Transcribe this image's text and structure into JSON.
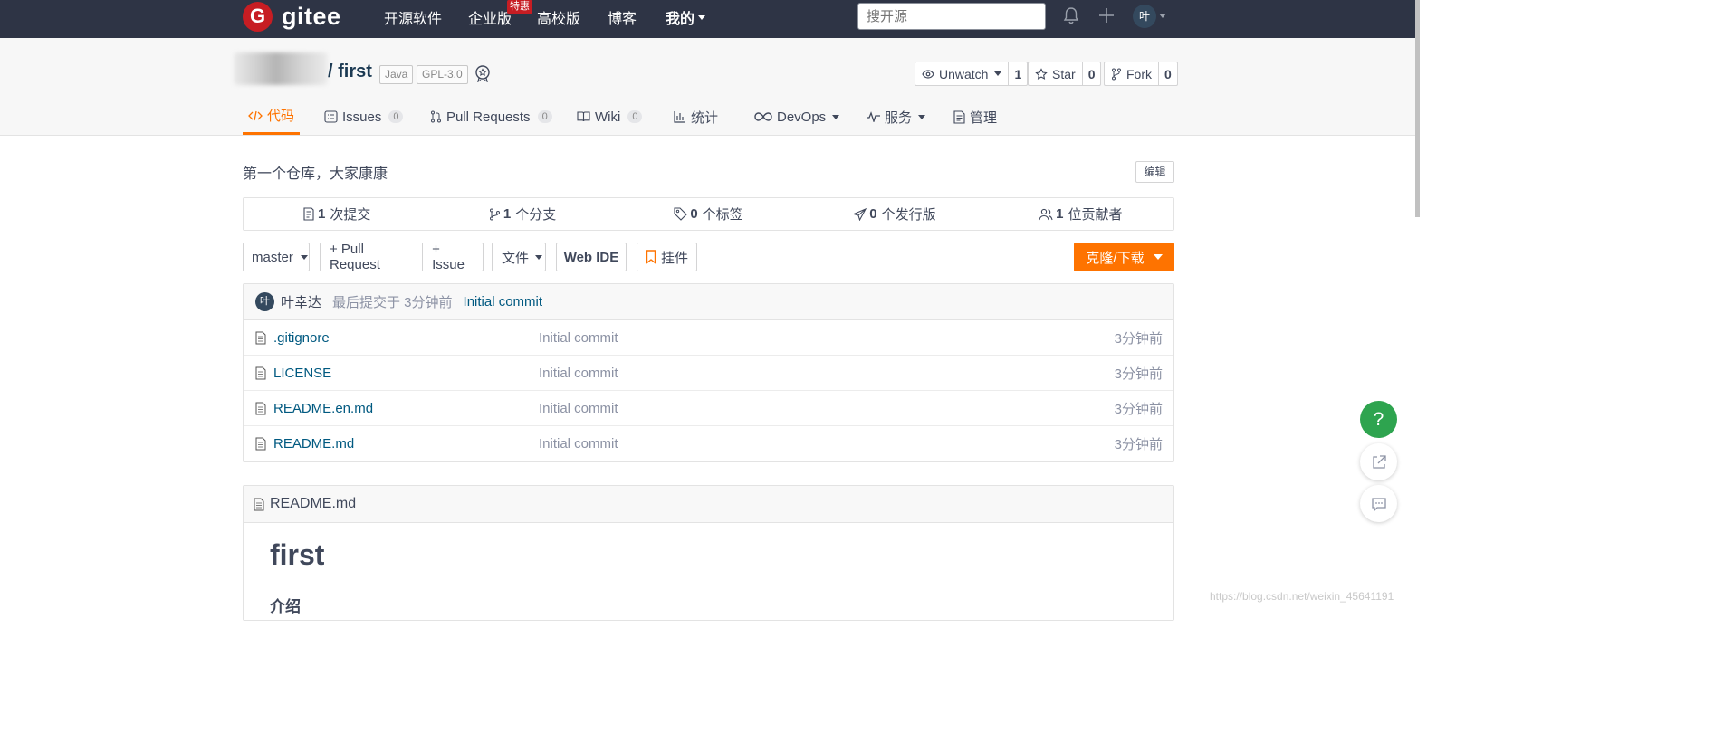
{
  "header": {
    "logo_letter": "G",
    "logo_text": "gitee",
    "nav": [
      "开源软件",
      "企业版",
      "高校版",
      "博客",
      "我的"
    ],
    "hot_badge": "特惠",
    "search_placeholder": "搜开源",
    "avatar_text": "叶"
  },
  "repo": {
    "name": "/ first",
    "tags": [
      "Java",
      "GPL-3.0"
    ],
    "watch": {
      "label": "Unwatch",
      "count": "1"
    },
    "star": {
      "label": "Star",
      "count": "0"
    },
    "fork": {
      "label": "Fork",
      "count": "0"
    }
  },
  "tabs": [
    {
      "label": "代码"
    },
    {
      "label": "Issues",
      "count": "0"
    },
    {
      "label": "Pull Requests",
      "count": "0"
    },
    {
      "label": "Wiki",
      "count": "0"
    },
    {
      "label": "统计"
    },
    {
      "label": "DevOps"
    },
    {
      "label": "服务"
    },
    {
      "label": "管理"
    }
  ],
  "description": "第一个仓库，大家康康",
  "edit_label": "编辑",
  "stats": [
    {
      "num": "1",
      "label": "次提交"
    },
    {
      "num": "1",
      "label": "个分支"
    },
    {
      "num": "0",
      "label": "个标签"
    },
    {
      "num": "0",
      "label": "个发行版"
    },
    {
      "num": "1",
      "label": "位贡献者"
    }
  ],
  "toolbar": {
    "branch": "master",
    "pull_request": "+ Pull Request",
    "issue": "+ Issue",
    "files": "文件",
    "webide": "Web IDE",
    "widget": "挂件",
    "clone": "克隆/下载"
  },
  "commit": {
    "avatar": "叶",
    "author": "叶幸达",
    "meta": "最后提交于 3分钟前",
    "message": "Initial commit"
  },
  "files": [
    {
      "name": ".gitignore",
      "msg": "Initial commit",
      "time": "3分钟前"
    },
    {
      "name": "LICENSE",
      "msg": "Initial commit",
      "time": "3分钟前"
    },
    {
      "name": "README.en.md",
      "msg": "Initial commit",
      "time": "3分钟前"
    },
    {
      "name": "README.md",
      "msg": "Initial commit",
      "time": "3分钟前"
    }
  ],
  "readme": {
    "filename": "README.md",
    "h1": "first",
    "h3": "介绍"
  },
  "help": "?",
  "watermark": "https://blog.csdn.net/weixin_45641191",
  "colors": {
    "accent": "#fe7300",
    "nav_bg": "#2e3445",
    "brand": "#c71d23",
    "help_green": "#2ea44f"
  }
}
